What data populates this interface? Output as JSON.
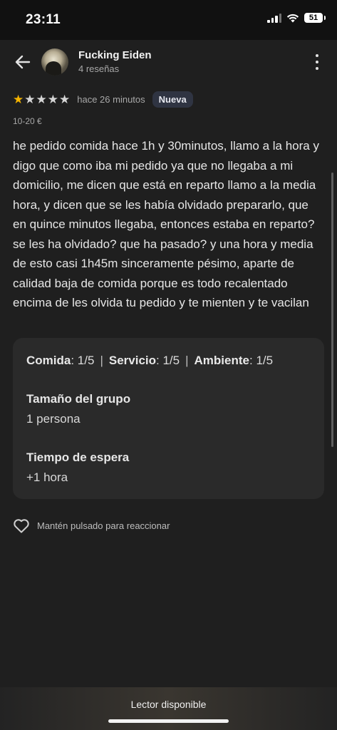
{
  "status_bar": {
    "time": "23:11",
    "battery": "51"
  },
  "header": {
    "name": "Fucking Eiden",
    "reviews": "4 reseñas"
  },
  "review": {
    "rating": 1,
    "max_rating": 5,
    "time_ago": "hace 26 minutos",
    "badge": "Nueva",
    "price": "10-20 €",
    "text": "he pedido comida hace 1h y 30minutos, llamo a la hora y digo que como iba mi pedido ya que no llegaba a mi domicilio, me dicen que está en reparto llamo a la media hora, y dicen que se les había olvidado prepararlo, que en quince minutos llegaba, entonces estaba en reparto? se les ha olvidado? que ha pasado? y una hora y media de esto casi 1h45m sinceramente pésimo, aparte de calidad baja de comida porque es todo recalentado encima de les olvida tu pedido y te mienten y te vacilan"
  },
  "details": {
    "food_label": "Comida",
    "food_value": "1/5",
    "service_label": "Servicio",
    "service_value": "1/5",
    "ambience_label": "Ambiente",
    "ambience_value": "1/5",
    "group_label": "Tamaño del grupo",
    "group_value": "1 persona",
    "wait_label": "Tiempo de espera",
    "wait_value": "+1 hora"
  },
  "reaction": {
    "label": "Mantén pulsado para reaccionar",
    "icon": "heart-outline-icon"
  },
  "bottom_bar": {
    "reader_label": "Lector disponible"
  },
  "colors": {
    "star": "#f5b400",
    "background": "#1f1f1f",
    "card": "#2a2a2a",
    "badge": "#2f3442"
  }
}
